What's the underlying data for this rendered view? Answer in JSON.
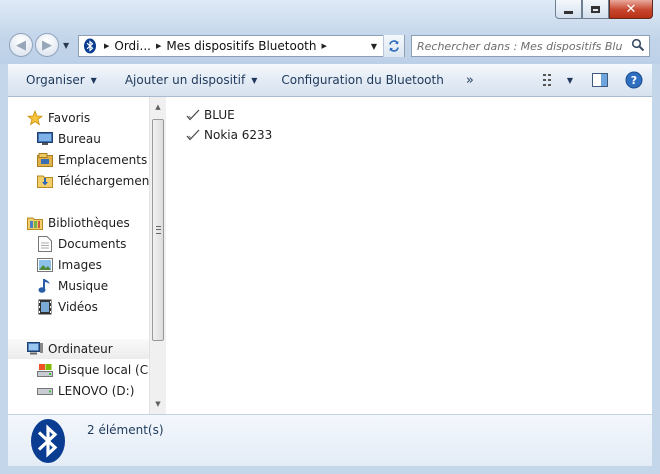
{
  "address": {
    "crumbs": [
      "Ordi...",
      "Mes dispositifs Bluetooth"
    ]
  },
  "search": {
    "placeholder": "Rechercher dans : Mes dispositifs Blue..."
  },
  "toolbar": {
    "organize_label": "Organiser",
    "add_device_label": "Ajouter un dispositif",
    "bluetooth_config_label": "Configuration du Bluetooth",
    "overflow_label": "»"
  },
  "nav": {
    "favorites": {
      "label": "Favoris",
      "items": [
        "Bureau",
        "Emplacements récents",
        "Téléchargements"
      ]
    },
    "libraries": {
      "label": "Bibliothèques",
      "items": [
        "Documents",
        "Images",
        "Musique",
        "Vidéos"
      ]
    },
    "computer": {
      "label": "Ordinateur",
      "items": [
        "Disque local (C:)",
        "LENOVO (D:)"
      ]
    }
  },
  "files": [
    "BLUE",
    "Nokia 6233"
  ],
  "details": {
    "count_text": "2 élément(s)"
  },
  "colors": {
    "frame": "#c4d6ea",
    "bluetooth_brand": "#0a3d91",
    "text_blue": "#1e395b"
  }
}
